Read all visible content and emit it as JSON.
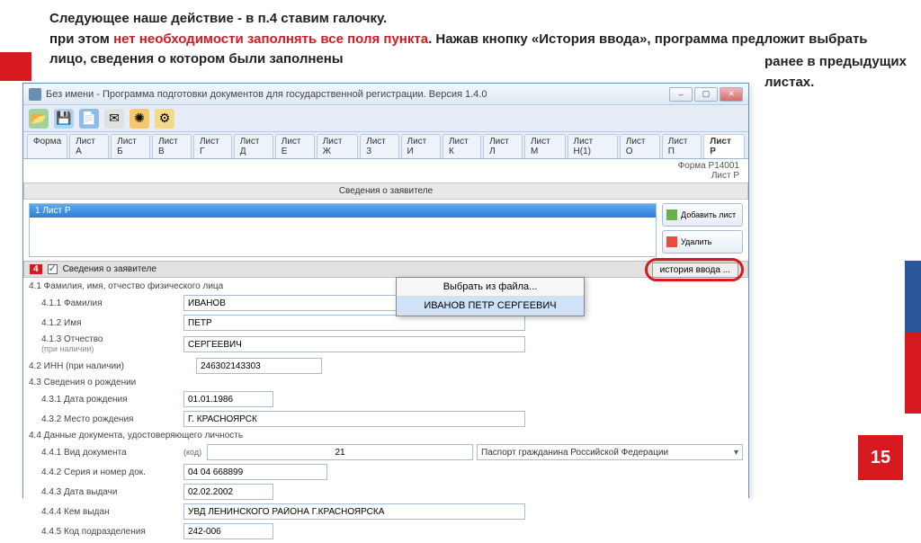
{
  "page": {
    "number": "15"
  },
  "explain": {
    "line1": "Следующее наше действие - в п.4 ставим галочку.",
    "line2a": "при этом ",
    "line2red": "нет необходимости заполнять все  поля пункта",
    "line2b": ". Нажав кнопку «История ввода», программа предложит выбрать лицо, сведения о котором были заполнены",
    "right": "ранее  в предыдущих листах."
  },
  "window": {
    "title": "Без имени - Программа подготовки документов для государственной регистрации. Версия 1.4.0",
    "form_info_a": "Форма Р14001",
    "form_info_b": "Лист Р"
  },
  "tabs": [
    "Форма",
    "Лист А",
    "Лист Б",
    "Лист В",
    "Лист Г",
    "Лист Д",
    "Лист Е",
    "Лист Ж",
    "Лист З",
    "Лист И",
    "Лист К",
    "Лист Л",
    "Лист М",
    "Лист Н(1)",
    "Лист О",
    "Лист П",
    "Лист Р"
  ],
  "section_hdr": "Сведения о заявителе",
  "list": {
    "item": "1 Лист Р",
    "add": "Добавить лист",
    "del": "Удалить"
  },
  "sec4": {
    "num": "4",
    "title": "Сведения о заявителе",
    "history_btn": "история ввода ..."
  },
  "sec41": {
    "title": "4.1   Фамилия, имя, отчество физического лица"
  },
  "fields": {
    "f411_lbl": "4.1.1   Фамилия",
    "f411_val": "ИВАНОВ",
    "f412_lbl": "4.1.2   Имя",
    "f412_val": "ПЕТР",
    "f413_lbl": "4.1.3   Отчество",
    "f413_note": "(при наличии)",
    "f413_val": "СЕРГЕЕВИЧ",
    "f42_lbl": "4.2   ИНН (при наличии)",
    "f42_val": "246302143303",
    "sec43": "4.3   Сведения о рождении",
    "f431_lbl": "4.3.1   Дата рождения",
    "f431_val": "01.01.1986",
    "f432_lbl": "4.3.2   Место рождения",
    "f432_val": "Г. КРАСНОЯРСК",
    "sec44": "4.4   Данные документа, удостоверяющего личность",
    "f441_lbl": "4.4.1   Вид документа",
    "f441_codelbl": "(код)",
    "f441_code": "21",
    "f441_val": "Паспорт гражданина Российской Федерации",
    "f442_lbl": "4.4.2   Серия и номер док.",
    "f442_val": "04 04 668899",
    "f443_lbl": "4.4.3   Дата выдачи",
    "f443_val": "02.02.2002",
    "f444_lbl": "4.4.4   Кем выдан",
    "f444_val": "УВД ЛЕНИНСКОГО РАЙОНА Г.КРАСНОЯРСКА",
    "f445_lbl": "4.4.5   Код подразделения",
    "f445_val": "242-006"
  },
  "popup": {
    "choose": "Выбрать из файла...",
    "person": "ИВАНОВ ПЕТР СЕРГЕЕВИЧ"
  }
}
